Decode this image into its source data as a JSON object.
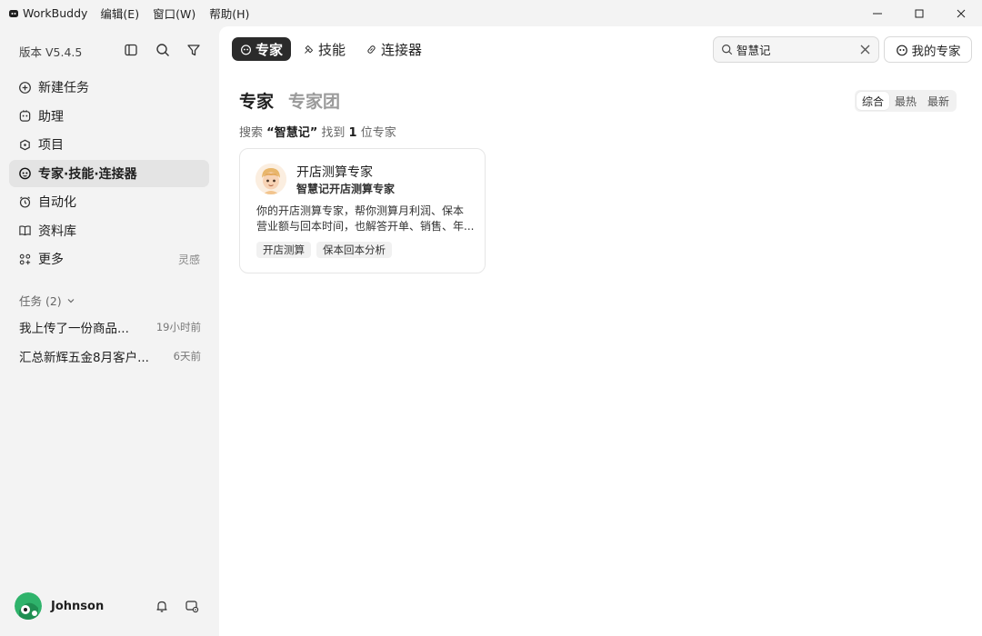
{
  "titlebar": {
    "app_name": "WorkBuddy",
    "menus": [
      "编辑(E)",
      "窗口(W)",
      "帮助(H)"
    ]
  },
  "sidebar": {
    "version": "版本 V5.4.5",
    "nav": [
      {
        "label": "新建任务",
        "icon": "plus-circle-icon"
      },
      {
        "label": "助理",
        "icon": "assistant-icon"
      },
      {
        "label": "项目",
        "icon": "project-icon"
      },
      {
        "label": "专家·技能·连接器",
        "icon": "expert-icon",
        "active": true
      },
      {
        "label": "自动化",
        "icon": "alarm-clock-icon"
      },
      {
        "label": "资料库",
        "icon": "book-icon"
      },
      {
        "label": "更多",
        "icon": "apps-icon",
        "hint": "灵感"
      }
    ],
    "tasks_header": "任务 (2)",
    "tasks": [
      {
        "title": "我上传了一份商品...",
        "time": "19小时前"
      },
      {
        "title": "汇总新辉五金8月客户...",
        "time": "6天前"
      }
    ],
    "user": {
      "name": "Johnson"
    }
  },
  "main": {
    "tabs": [
      "专家",
      "技能",
      "连接器"
    ],
    "search": {
      "value": "智慧记"
    },
    "my_experts_label": "我的专家",
    "heading_tabs": [
      "专家",
      "专家团"
    ],
    "sort_options": [
      "综合",
      "最热",
      "最新"
    ],
    "result": {
      "prefix": "搜索",
      "query": "“智慧记”",
      "middle": "找到",
      "count": "1",
      "suffix": "位专家"
    },
    "cards": [
      {
        "title": "开店测算专家",
        "subtitle": "智慧记开店测算专家",
        "desc_line1": "你的开店测算专家，帮你测算月利润、保本",
        "desc_line2": "营业额与回本时间，也解答开单、销售、年...",
        "tags": [
          "开店测算",
          "保本回本分析"
        ]
      }
    ]
  },
  "colors": {
    "background": "#f3f3f3",
    "panel": "#ffffff",
    "active_tab": "#2b2b2b",
    "avatar_green": "#2fb36b"
  }
}
